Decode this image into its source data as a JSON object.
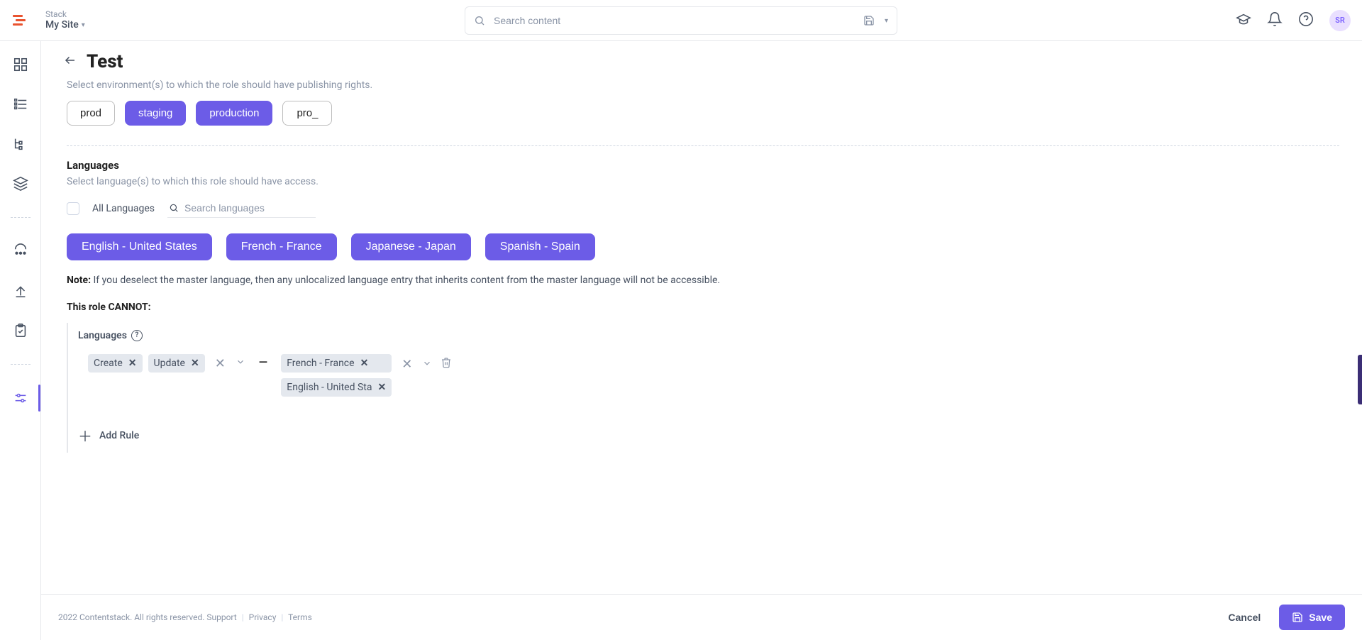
{
  "header": {
    "stack_label": "Stack",
    "stack_name": "My Site",
    "search_placeholder": "Search content",
    "avatar": "SR"
  },
  "page": {
    "title": "Test"
  },
  "publishing": {
    "desc": "Select environment(s) to which the role should have publishing rights.",
    "environments": [
      {
        "label": "prod",
        "selected": false
      },
      {
        "label": "staging",
        "selected": true
      },
      {
        "label": "production",
        "selected": true
      },
      {
        "label": "pro_",
        "selected": false
      }
    ]
  },
  "languages_section": {
    "title": "Languages",
    "desc": "Select language(s) to which this role should have access.",
    "all_label": "All Languages",
    "search_placeholder": "Search languages",
    "languages": [
      "English - United States",
      "French - France",
      "Japanese - Japan",
      "Spanish - Spain"
    ],
    "note_prefix": "Note:",
    "note_text": " If you deselect the master language, then any unlocalized language entry that inherits content from the master language will not be accessible."
  },
  "cannot": {
    "title": "This role CANNOT:",
    "block_title": "Languages",
    "rule": {
      "actions": [
        "Create",
        "Update"
      ],
      "languages": [
        "French - France",
        "English - United Sta"
      ]
    },
    "add_rule": "Add Rule"
  },
  "footer": {
    "copyright": "2022 Contentstack. All rights reserved.",
    "support": "Support",
    "privacy": "Privacy",
    "terms": "Terms",
    "cancel": "Cancel",
    "save": "Save"
  }
}
